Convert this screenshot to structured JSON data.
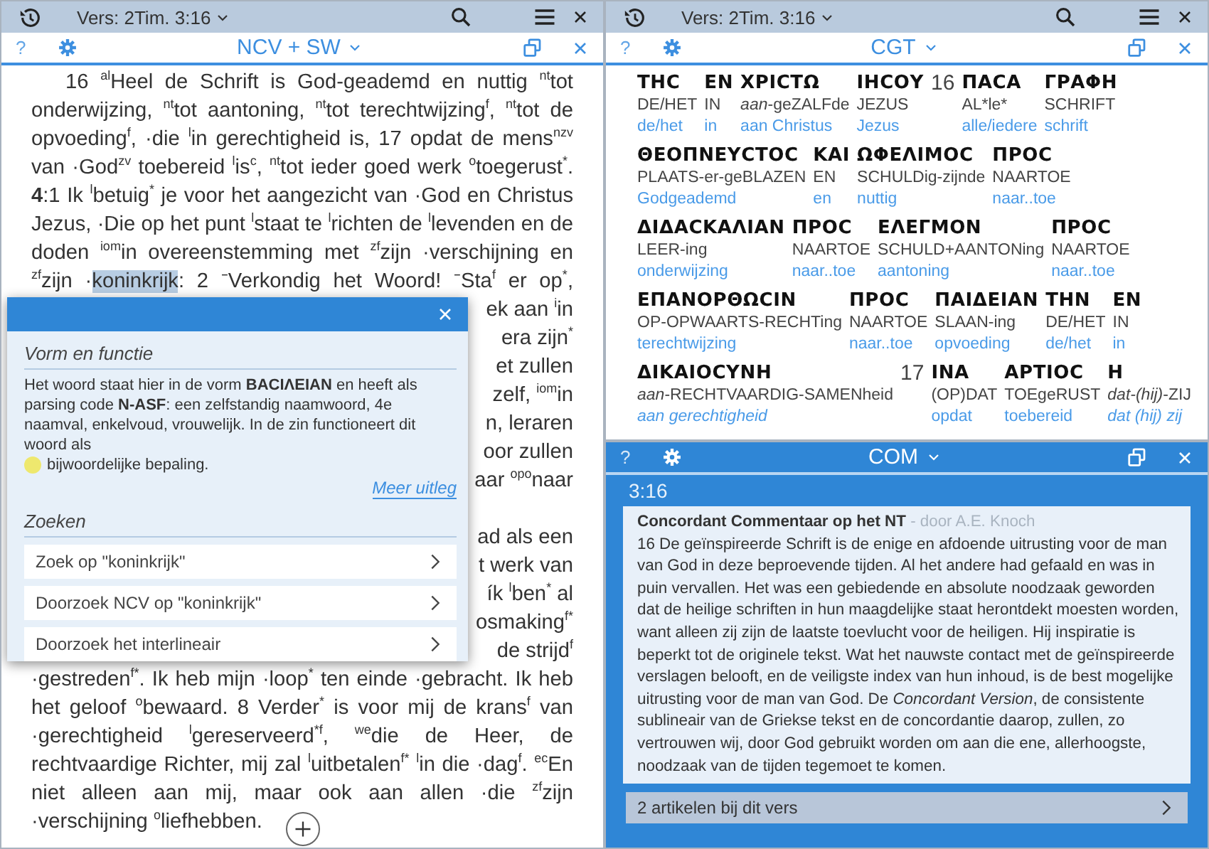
{
  "left_pane": {
    "top_bar": {
      "verse_label": "Vers: 2Tim. 3:16"
    },
    "toolbar": {
      "help": "?",
      "title": "NCV + SW"
    },
    "text_lines": [
      {
        "kind": "indent",
        "text": "16 $^{al}$Heel de Schrift is God-geademd en nuttig $^{nt}$tot"
      },
      {
        "kind": "full",
        "text": "onderwijzing, $^{nt}$tot aantoning, $^{nt}$tot terechtwijzing$^{f}$, $^{nt}$tot de"
      },
      {
        "kind": "full",
        "text": "opvoeding$^{f}$, ·die $^{l}$in gerechtigheid is, 17 opdat de mens$^{nzv}$"
      },
      {
        "kind": "full",
        "text": "van ·God$^{zv}$ toebereid $^{l}$is$^{c}$, $^{nt}$tot ieder goed werk $^{o}$toegerust$^{*}$."
      },
      {
        "kind": "full",
        "text": "**4**:1 Ik $^{l}$betuig$^{*}$ je voor het aangezicht van ·God en Christus"
      },
      {
        "kind": "full",
        "text": "Jezus, ·Die op het punt $^{l}$staat te $^{l}$richten de $^{l}$levenden en de"
      },
      {
        "kind": "full",
        "text": "doden $^{iom}$in overeenstemming met $^{zf}$zijn ·verschijning en"
      },
      {
        "kind": "full",
        "parts": [
          {
            "text": "$^{zf}$zijn ·",
            "selected": false
          },
          {
            "text": "koninkrijk",
            "selected": true
          },
          {
            "text": ": 2 ⁻Verkondig het Woord! ⁻Sta$^{f}$ er op$^{*}$,",
            "selected": false
          }
        ]
      },
      {
        "kind": "fragment",
        "text": "ek aan $^{i}$in"
      },
      {
        "kind": "fragment",
        "text": "era zijn$^{*}$"
      },
      {
        "kind": "fragment",
        "text": "et zullen"
      },
      {
        "kind": "fragment",
        "text": "zelf, $^{iom}$in"
      },
      {
        "kind": "fragment",
        "text": "n, leraren"
      },
      {
        "kind": "fragment",
        "text": "oor zullen"
      },
      {
        "kind": "fragment",
        "text": "aar $^{opo}$naar"
      },
      {
        "kind": "break"
      },
      {
        "kind": "fragment",
        "text": "ad als een"
      },
      {
        "kind": "fragment",
        "text": "t werk van"
      },
      {
        "kind": "fragment",
        "text": "ík $^{l}$ben$^{*}$ al"
      },
      {
        "kind": "fragment",
        "text": "osmaking$^{f*}$"
      },
      {
        "kind": "fragment",
        "text": "de strijd$^{f}$"
      },
      {
        "kind": "full",
        "text": "·gestreden$^{f*}$. Ik heb mijn ·loop$^{*}$ ten einde ·gebracht. Ik heb"
      },
      {
        "kind": "full",
        "text": "het geloof $^{o}$bewaard. 8 Verder$^{*}$ is voor mij de krans$^{f}$ van"
      },
      {
        "kind": "full",
        "text": "·gerechtigheid $^{l}$gereserveerd$^{*f}$, $^{we}$die de Heer, de"
      },
      {
        "kind": "full",
        "text": "rechtvaardige Richter, mij zal $^{l}$uitbetalen$^{f*}$ $^{l}$in die ·dag$^{f}$. $^{ec}$En"
      },
      {
        "kind": "full",
        "text": "niet alleen aan mij, maar ook aan allen ·die $^{zf}$zijn"
      },
      {
        "kind": "end",
        "text": "·verschijning $^{o}$liefhebben."
      }
    ],
    "popup": {
      "form_heading": "Vorm en functie",
      "description": "Het woord staat hier in de vorm **ΒΑϹΙΛΕΙΑΝ** en heeft als parsing code **N-ASF**: een zelfstandig naamwoord, 4e naamval, enkelvoud, vrouwelijk. In de zin functioneert dit woord als",
      "description_end": "bijwoordelijke bepaling.",
      "more_link": "Meer uitleg",
      "search_heading": "Zoeken",
      "search_items": [
        "Zoek op \"koninkrijk\"",
        "Doorzoek NCV op \"koninkrijk\"",
        "Doorzoek het interlineair"
      ]
    }
  },
  "right_pane": {
    "top_bar": {
      "verse_label": "Vers: 2Tim. 3:16"
    },
    "toolbar": {
      "help": "?",
      "title": "CGT"
    },
    "interlinear_rows": [
      [
        {
          "kind": "word",
          "greek": "ΤΗϹ",
          "gloss": "DE/HET",
          "translation": "de/het"
        },
        {
          "kind": "word",
          "greek": "ΕΝ",
          "gloss": "IN",
          "translation": "in"
        },
        {
          "kind": "word",
          "greek": "ΧΡΙϹΤΩ",
          "gloss": "*aan*-geZALFde",
          "translation": "aan Christus"
        },
        {
          "kind": "word",
          "greek": "ΙΗϹΟΥ",
          "gloss": "JEZUS",
          "translation": "Jezus"
        },
        {
          "kind": "verse",
          "number": "16"
        },
        {
          "kind": "word",
          "greek": "ΠΑϹΑ",
          "gloss": "AL*le*",
          "translation": "alle/iedere"
        },
        {
          "kind": "word",
          "greek": "ΓΡΑΦΗ",
          "gloss": "SCHRIFT",
          "translation": "schrift"
        }
      ],
      [
        {
          "kind": "word",
          "greek": "ΘΕΟΠΝΕΥϹΤΟϹ",
          "gloss": "PLAATS-er-geBLAZEN",
          "translation": "Godgeademd"
        },
        {
          "kind": "word",
          "greek": "ΚΑΙ",
          "gloss": "EN",
          "translation": "en"
        },
        {
          "kind": "word",
          "greek": "ΩΦΕΛΙΜΟϹ",
          "gloss": "SCHULDig-zijnde",
          "translation": "nuttig"
        },
        {
          "kind": "word",
          "greek": "ΠΡΟϹ",
          "gloss": "NAARTOE",
          "translation": "naar..toe"
        }
      ],
      [
        {
          "kind": "word",
          "greek": "ΔΙΔΑϹΚΑΛΙΑΝ",
          "gloss": "LEER-ing",
          "translation": "onderwijzing"
        },
        {
          "kind": "word",
          "greek": "ΠΡΟϹ",
          "gloss": "NAARTOE",
          "translation": "naar..toe"
        },
        {
          "kind": "word",
          "greek": "ΕΛΕΓΜΟΝ",
          "gloss": "SCHULD+AANTONing",
          "translation": "aantoning"
        },
        {
          "kind": "word",
          "greek": "ΠΡΟϹ",
          "gloss": "NAARTOE",
          "translation": "naar..toe"
        }
      ],
      [
        {
          "kind": "word",
          "greek": "ΕΠΑΝΟΡΘΩϹΙΝ",
          "gloss": "OP-OPWAARTS-RECHTing",
          "translation": "terechtwijzing"
        },
        {
          "kind": "word",
          "greek": "ΠΡΟϹ",
          "gloss": "NAARTOE",
          "translation": "naar..toe"
        },
        {
          "kind": "word",
          "greek": "ΠΑΙΔΕΙΑΝ",
          "gloss": "SLAAN-ing",
          "translation": "opvoeding"
        },
        {
          "kind": "word",
          "greek": "ΤΗΝ",
          "gloss": "DE/HET",
          "translation": "de/het"
        },
        {
          "kind": "word",
          "greek": "ΕΝ",
          "gloss": "IN",
          "translation": "in"
        }
      ],
      [
        {
          "kind": "word",
          "greek": "ΔΙΚΑΙΟϹΥΝΗ",
          "gloss": "*aan*-RECHTVAARDIG-SAMENheid",
          "translation": "*aan gerechtigheid*"
        },
        {
          "kind": "verse",
          "number": "17"
        },
        {
          "kind": "word",
          "greek": "ΙΝΑ",
          "gloss": "(OP)DAT",
          "translation": "opdat"
        },
        {
          "kind": "word",
          "greek": "ΑΡΤΙΟϹ",
          "gloss": "TOEgeRUST",
          "translation": "toebereid"
        },
        {
          "kind": "word",
          "greek": "Η",
          "gloss": "*dat-(hij)*-ZIJ",
          "translation": "*dat (hij) zij*"
        }
      ]
    ]
  },
  "commentary_pane": {
    "toolbar": {
      "help": "?",
      "title": "COM"
    },
    "verse_ref": "3:16",
    "card": {
      "title": "Concordant Commentaar op het NT",
      "author": "- door A.E. Knoch",
      "body": "16 De geïnspireerde Schrift is de enige en afdoende uitrusting voor de man van God in deze beproevende tijden. Al het andere had gefaald en was in puin vervallen. Het was een gebiedende en absolute noodzaak geworden dat de heilige schriften in hun maagdelijke staat herontdekt moesten worden, want alleen zij zijn de laatste toevlucht voor de heiligen. Hij inspiratie is beperkt tot de originele tekst. Wat het nauwste contact met de geïnspireerde verslagen belooft, en de veiligste index van hun inhoud, is de best mogelijke uitrusting voor de man van God. De *Concordant Version*, de consistente sublineair van de Griekse tekst en de concordantie daarop, zullen, zo vertrouwen wij, door God gebruikt worden om aan die ene, allerhoogste, noodzaak van de tijden tegemoet te komen."
    },
    "articles_link": "2 artikelen bij dit vers"
  }
}
